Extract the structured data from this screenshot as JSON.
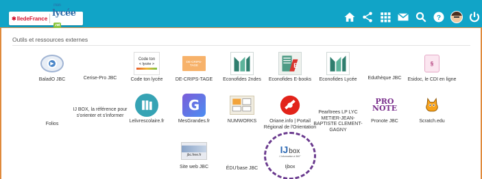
{
  "header": {
    "brand_region": "IledeFrance",
    "brand_mon": "mon",
    "brand_lycee": "lycée",
    "brand_badge": ".net",
    "nav_icons": [
      "home-icon",
      "share-icon",
      "apps-grid-icon",
      "mail-icon",
      "search-icon",
      "help-icon",
      "avatar",
      "power-icon"
    ]
  },
  "section": {
    "title": "Outils et ressources externes"
  },
  "tiles": [
    {
      "label": "BaladO JBC",
      "icon": "podcast-icon"
    },
    {
      "label": "Cerise-Pro JBC",
      "icon": ""
    },
    {
      "label": "Code ton lycée",
      "icon": "code-ton-lycee-logo",
      "logo_line1": "Code ton",
      "logo_line2": "< lycée >"
    },
    {
      "label": "DE-CRIPS-TAGE",
      "icon": "decrips-logo",
      "logo_text": "DE-CRIPS-TAGE"
    },
    {
      "label": "Econofides 2ndes",
      "icon": "econofides-logo"
    },
    {
      "label": "Econofides E-books",
      "icon": "econofides-ebooks-logo"
    },
    {
      "label": "Econofides Lycée",
      "icon": "econofides-logo"
    },
    {
      "label": "Eduthèque JBC",
      "icon": ""
    },
    {
      "label": "Esidoc, le CDI en ligne",
      "icon": "esidoc-logo"
    },
    {
      "label": "Folios",
      "icon": ""
    },
    {
      "label": "IJ BOX, la référence pour s'orienter et s'informer",
      "icon": ""
    },
    {
      "label": "Lelivrescolaire.fr",
      "icon": "lelivrescolaire-logo"
    },
    {
      "label": "MesGrandes.fr",
      "icon": "mesgranules-logo",
      "logo_text": "G"
    },
    {
      "label": "NUMWORKS",
      "icon": "numworks-logo"
    },
    {
      "label": "Oriane.info | Portail Régional de l'Orientation",
      "icon": "oriane-logo"
    },
    {
      "label": "Pearltrees LP LYC METIER-JEAN-BAPTISTE CLEMENT-GAGNY",
      "icon": ""
    },
    {
      "label": "Pronote JBC",
      "icon": "pronote-logo",
      "logo_line1": "PRO",
      "logo_line2": "NOTE"
    },
    {
      "label": "Scratch.edu",
      "icon": "scratch-cat-icon"
    },
    {
      "label": "Site web JBC",
      "icon": "site-web-jbc-thumbnail",
      "logo_text": "jbc.free.fr"
    },
    {
      "label": "ÉDU'base JBC",
      "icon": ""
    },
    {
      "label": "Ijbox",
      "icon": "ijbox-logo",
      "logo_text": "box",
      "logo_prefix": "IJ",
      "logo_sub": "L'information à 360°"
    }
  ],
  "colors": {
    "header": "#11a4c7",
    "frame": "#e08a3c",
    "highlight": "#6a3a8e"
  }
}
